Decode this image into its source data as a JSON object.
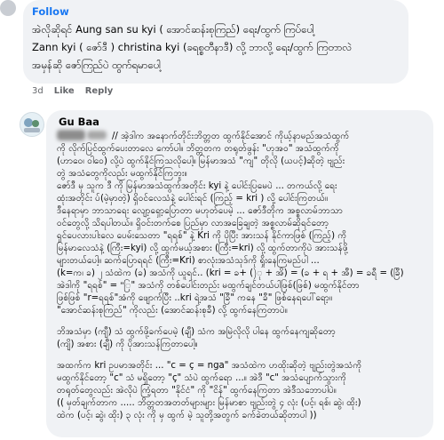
{
  "comment1": {
    "author_label": "",
    "follow_label": "Follow",
    "lines": [
      "အဲလိုဆိုရင် Aung san su kyi ( အောင်ဆန်းစုကြည်) ရေး/ထွက် ကြပ်ပေါ့",
      "Zann kyi ( ဇော်ဒီ ) christina kyi (ခရစ္စတီနာဒီ) လို့ ဘာလို့ ရေး/ထွက် ကြတာလဲ",
      "အမှန်ဆို ဇော်ကြည်ပဲ ထွက်ရမာပေါ့"
    ],
    "time": "3d",
    "like_label": "Like",
    "reply_label": "Reply"
  },
  "comment2": {
    "author": "Gu Baa",
    "lines": [
      "// အဲ့ဒါက အနောက်တိုင်းဘိတ္တတ ထွက်နိုင်အောင် ကိုယ့်နာမည်အသံထွက်",
      "ကို လိုက်ပြင်ထွက်ပေးတာလေ ကော်ပါ။ ဘိတ္တတက တရုတ်ဖွန်း \"ဟုအဝ\" အသံထွက်ကို",
      "(ဟာဝေ၊ ဝါဝေ) လို့ပဲ ထွက်နိုင်ကြသလိုပေါ့။ မြန်မာအသံ \"ကျ\" တိုလို (ယပင့်)ဆိုတဲ့ ဗျည်း",
      "တွဲ အသံတွေကိုလည်း မထွက်နိုင်ကြဘူး။",
      "ဇော်ဒီ မှ သူက ဒီ ကို မြန်မာအသံထွက်အတိုင်း kyi နဲ့ ပေါင်းပြမေပဲ ... တကယ်လို့ ရေး",
      "ထုံးအတိုင်း ပ်(မဲ့မှာတဲ့) ရှိဝင်လေသံနဲ့ ပေါင်းရင် (ကြည့် = kri ) လို့ ပေါင်းကြတယ်။",
      "ဒီနေရာမှာ ဘာသာရေး လျော့ရှော့ပြောတာ မဟုတ်ပေမဲ့ ... ဇော်ဒီတိုက အစ္စလာမ်ဘာသာ",
      "ဝင်တွေလို့ သိရပါတယ်။ ရှိဝင်းတက်စေ ပြည်မှာ လာအခြေချတဲ့ အစ္စလာမ်ဆိုရင်တော့",
      "ရှင်ပေလားပါးလေ ပေမ်းသေတာ \"ရရစ်\" နဲ့ Kri ကို ပိုပြီး အားသန် နိုင်ကာဖြစ် (ကြည့်) ကို",
      "မြန်မာလေသံနဲ့ (ကြီး=kyi) လို့ ထွက်မယ့်အစား (ကြီး=kri) လို့ ထွက်တာကိုပဲ အားသန်ဖို့",
      "များတယ်ပေါ့။ ဆက်ပြောရရင် (ကြီး=Kri) စာလုံးအသံသုဒ်ကို ရှိုးနေကြမည်ပါ ...",
      "(k=က၊ ခ) ၂ သံထဲက (ခ) အသံကို ယူရင်.. (kri = ခ+ ()ု + အိ) = (ခ + ရ + အီ) = ခရီ = (ခြီ)",
      "အဲဒါကို \"ရရစ်\" = \"ြ\" အသံကို တစ်ပေါင်းတည်း မထွက်ချင်တယ်ပါဖြစ်(ဖြစ်) မထွက်နိုင်တာ",
      "ဖြစ်ဖြစ် \"r=ရရစ်\"အံကို ဖျောက်ပြီး ..kri ရဲ့အသံ \"ခြီ\" ကနေ \"ခီ\" ဖြစ်နေရပေါ်ရော့။",
      "\"အောင်ဆန်းစုကြည်\" ကိုလည်း (အောင်ဆန်းစုခီ) လို့ ထွက်နေကြတာပဲ။",
      "ဘိအသံမှာ (ကျီ) သံ ထွက်ဖို့ခက်ပေမဲ့ (ချီ) သံက အမြဲလိုလို ပါနေ ထွက်နေကျဆိုတော့",
      "(ကျိ) အစား (ချီ) ကို ပိုအားသန်ကြတာပေါ့။",
      "အထက်က kri ဥပမာအတိုင်း ... \"c = ç = nga\" အသံထဲက ဟထိုးဆိုတဲ့ ဗျည်းတွဲအသံကို",
      "မထွက်နိုင်တော့ \"c\" သံ မရှိတော့ \"ç\" သံပဲ ထွက်ရော ...။ အဲဒီ \"c\" အသံပျောက်သွားကို",
      "တရုတ်တွေလည်း အဲလိုပဲ ကြံ့ရတာ \"နိုင်ငံ\" ကို \"ငိန်\" ထွက်နေကြတာ အဲဒီသဘောပါပဲ။",
      "(( မှတ်ချက်တာက ..... ဘိတ္တတအတတ်များများ မြန်မာစာ ဗျည်းတွဲ ၄ လုံး (ပင့်၊ ရစ်၊ ဆွဲ၊ ထိုး)",
      "ထဲက (ပင့်၊ ဆွဲ၊ ထိုး) ၃ လုံး ကို မှ ထွက် မဲ့ သူတို့အတွက် ခက်ခဲတယ်ဆိုတာပါ ))"
    ]
  }
}
